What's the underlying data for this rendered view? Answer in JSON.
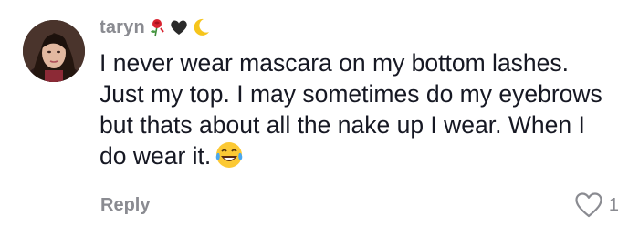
{
  "comment": {
    "username": "taryn",
    "username_emojis": [
      "rose-icon",
      "black-heart-icon",
      "crescent-moon-icon"
    ],
    "text": "I never wear mascara on my bottom lashes. Just my top. I may sometimes do my eyebrows but thats about all the nake up I wear. When I do wear it.",
    "trailing_emoji": "laughing-tears-icon",
    "reply_label": "Reply",
    "like_count": "1"
  },
  "colors": {
    "meta_text": "#8a8b91",
    "body_text": "#161823",
    "background": "#ffffff"
  }
}
